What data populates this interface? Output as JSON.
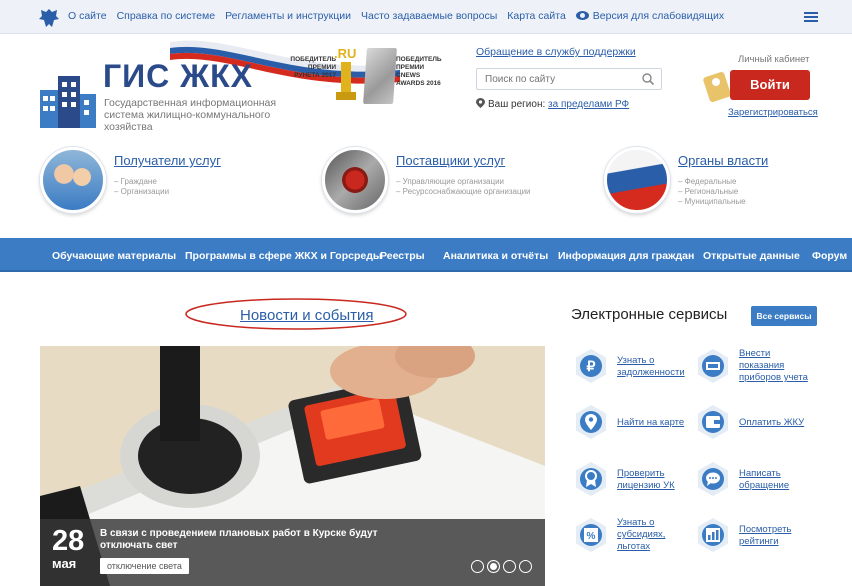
{
  "topbar": {
    "links": [
      "О сайте",
      "Справка по системе",
      "Регламенты и инструкции",
      "Часто задаваемые вопросы",
      "Карта сайта"
    ],
    "accessibility": "Версия для слабовидящих"
  },
  "header": {
    "logo_title": "ГИС ЖКХ",
    "logo_subtitle": "Государственная информационная система жилищно-коммунального хозяйства",
    "award_left": "ПОБЕДИТЕЛЬ ПРЕМИИ РУНЕТА 2017",
    "award_ru": ".RU",
    "award_right": "ПОБЕДИТЕЛЬ ПРЕМИИ CNEWS AWARDS 2016",
    "support_link": "Обращение в службу поддержки",
    "search_placeholder": "Поиск по сайту",
    "region_label": "Ваш регион:",
    "region_value": "за пределами РФ",
    "cabinet_label": "Личный кабинет",
    "login_label": "Войти",
    "register_label": "Зарегистрироваться"
  },
  "categories": [
    {
      "title": "Получатели услуг",
      "items": [
        "– Граждане",
        "– Организации"
      ]
    },
    {
      "title": "Поставщики услуг",
      "items": [
        "– Управляющие организации",
        "– Ресурсоснабжающие организации"
      ]
    },
    {
      "title": "Органы власти",
      "items": [
        "– Федеральные",
        "– Региональные",
        "– Муниципальные"
      ]
    }
  ],
  "nav": [
    "Обучающие материалы",
    "Программы в сфере ЖКХ и Горсреды",
    "Реестры",
    "Аналитика и отчёты",
    "Информация для граждан",
    "Открытые данные",
    "Форум"
  ],
  "news": {
    "heading": "Новости и события",
    "day": "28",
    "month": "мая",
    "text": "В связи с проведением плановых работ в Курске будут отключать свет",
    "tag": "отключение света"
  },
  "services": {
    "heading": "Электронные сервисы",
    "all_button": "Все сервисы",
    "items": [
      "Узнать о\nзадолженности",
      "Внести\nпоказания\nприборов учета",
      "Найти на карте",
      "Оплатить ЖКУ",
      "Проверить\nлицензию УК",
      "Написать\nобращение",
      "Узнать о\nсубсидиях,\nльготах",
      "Посмотреть\nрейтинги"
    ]
  },
  "colors": {
    "accent": "#2a5ea8",
    "nav": "#3b7cc4",
    "login": "#c8281e"
  }
}
